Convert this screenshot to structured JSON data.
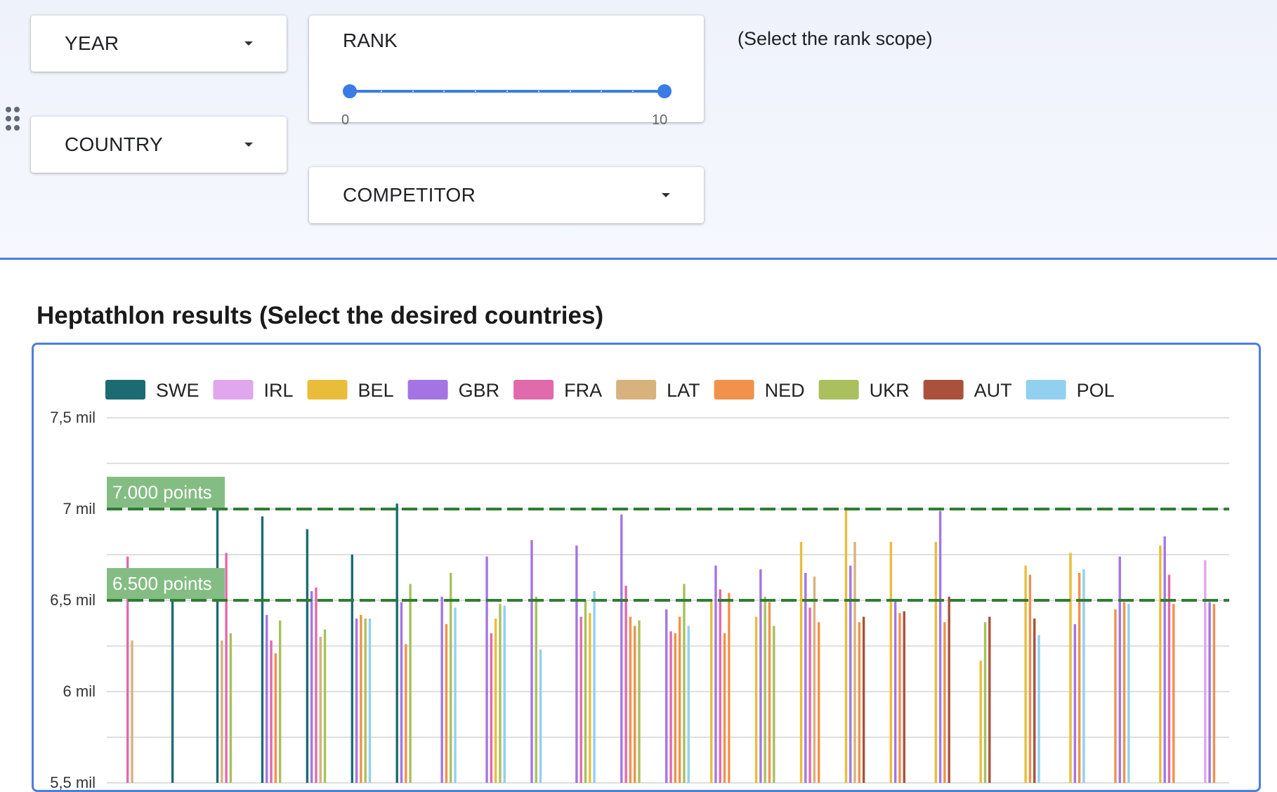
{
  "filters": {
    "year_label": "YEAR",
    "country_label": "COUNTRY",
    "competitor_label": "COMPETITOR",
    "rank": {
      "label": "RANK",
      "min": 0,
      "max": 10,
      "low": 0,
      "high": 10,
      "min_label": "0",
      "max_label": "10"
    },
    "rank_hint": "(Select the rank scope)"
  },
  "colors": {
    "accent": "#4a7fdd",
    "slider": "#3b7be6",
    "reference_line": "#2e7d32",
    "reference_label_bg": "#84bd84"
  },
  "chart": {
    "title": "Heptathlon results (Select the desired countries)"
  },
  "chart_data": {
    "type": "bar",
    "ylim": [
      5500,
      7500
    ],
    "y_ticks": [
      {
        "value": 7500,
        "label": "7,5 mil"
      },
      {
        "value": 7000,
        "label": "7 mil"
      },
      {
        "value": 6500,
        "label": "6,5 mil"
      },
      {
        "value": 6000,
        "label": "6 mil"
      },
      {
        "value": 5500,
        "label": "5,5 mil"
      }
    ],
    "grid_values": [
      7500,
      7250,
      7000,
      6750,
      6500,
      6250,
      6000,
      5750,
      5500
    ],
    "grid": true,
    "legend_position": "top",
    "reference_lines": [
      {
        "value": 7000,
        "label": "7.000 points"
      },
      {
        "value": 6500,
        "label": "6.500 points"
      }
    ],
    "series": [
      {
        "name": "SWE",
        "color": "#1c6b73"
      },
      {
        "name": "IRL",
        "color": "#e0a6ee"
      },
      {
        "name": "BEL",
        "color": "#e9bd3a"
      },
      {
        "name": "GBR",
        "color": "#a475e2"
      },
      {
        "name": "FRA",
        "color": "#e06aab"
      },
      {
        "name": "LAT",
        "color": "#d7b27c"
      },
      {
        "name": "NED",
        "color": "#f0924a"
      },
      {
        "name": "UKR",
        "color": "#a9c05d"
      },
      {
        "name": "AUT",
        "color": "#a9513c"
      },
      {
        "name": "POL",
        "color": "#91d0ef"
      }
    ],
    "groups": [
      [
        [
          "FRA",
          6740
        ],
        [
          "LAT",
          6280
        ]
      ],
      [
        [
          "SWE",
          6500
        ]
      ],
      [
        [
          "SWE",
          7000
        ],
        [
          "LAT",
          6280
        ],
        [
          "FRA",
          6760
        ],
        [
          "UKR",
          6320
        ]
      ],
      [
        [
          "SWE",
          6960
        ],
        [
          "GBR",
          6420
        ],
        [
          "FRA",
          6280
        ],
        [
          "NED",
          6210
        ],
        [
          "UKR",
          6390
        ]
      ],
      [
        [
          "SWE",
          6890
        ],
        [
          "GBR",
          6550
        ],
        [
          "FRA",
          6570
        ],
        [
          "LAT",
          6300
        ],
        [
          "UKR",
          6340
        ]
      ],
      [
        [
          "SWE",
          6750
        ],
        [
          "GBR",
          6400
        ],
        [
          "NED",
          6420
        ],
        [
          "UKR",
          6400
        ],
        [
          "POL",
          6400
        ]
      ],
      [
        [
          "SWE",
          7030
        ],
        [
          "GBR",
          6490
        ],
        [
          "NED",
          6260
        ],
        [
          "UKR",
          6590
        ]
      ],
      [
        [
          "GBR",
          6520
        ],
        [
          "NED",
          6370
        ],
        [
          "UKR",
          6650
        ],
        [
          "POL",
          6460
        ]
      ],
      [
        [
          "GBR",
          6740
        ],
        [
          "FRA",
          6320
        ],
        [
          "BEL",
          6400
        ],
        [
          "UKR",
          6480
        ],
        [
          "POL",
          6470
        ]
      ],
      [
        [
          "GBR",
          6830
        ],
        [
          "UKR",
          6520
        ],
        [
          "POL",
          6230
        ]
      ],
      [
        [
          "GBR",
          6800
        ],
        [
          "FRA",
          6410
        ],
        [
          "UKR",
          6500
        ],
        [
          "BEL",
          6430
        ],
        [
          "POL",
          6550
        ]
      ],
      [
        [
          "GBR",
          6970
        ],
        [
          "FRA",
          6580
        ],
        [
          "NED",
          6410
        ],
        [
          "NED",
          6360
        ],
        [
          "UKR",
          6390
        ]
      ],
      [
        [
          "GBR",
          6450
        ],
        [
          "FRA",
          6330
        ],
        [
          "NED",
          6320
        ],
        [
          "NED",
          6410
        ],
        [
          "UKR",
          6590
        ],
        [
          "POL",
          6360
        ]
      ],
      [
        [
          "BEL",
          6500
        ],
        [
          "GBR",
          6690
        ],
        [
          "FRA",
          6560
        ],
        [
          "NED",
          6320
        ],
        [
          "NED",
          6540
        ]
      ],
      [
        [
          "BEL",
          6410
        ],
        [
          "GBR",
          6670
        ],
        [
          "UKR",
          6520
        ],
        [
          "NED",
          6490
        ],
        [
          "UKR",
          6360
        ]
      ],
      [
        [
          "BEL",
          6820
        ],
        [
          "GBR",
          6650
        ],
        [
          "FRA",
          6460
        ],
        [
          "LAT",
          6630
        ],
        [
          "NED",
          6380
        ]
      ],
      [
        [
          "BEL",
          7010
        ],
        [
          "GBR",
          6690
        ],
        [
          "LAT",
          6820
        ],
        [
          "NED",
          6380
        ],
        [
          "AUT",
          6410
        ]
      ],
      [
        [
          "BEL",
          6820
        ],
        [
          "GBR",
          6500
        ],
        [
          "NED",
          6430
        ],
        [
          "AUT",
          6440
        ]
      ],
      [
        [
          "BEL",
          6820
        ],
        [
          "GBR",
          6990
        ],
        [
          "NED",
          6380
        ],
        [
          "AUT",
          6520
        ]
      ],
      [
        [
          "BEL",
          6170
        ],
        [
          "UKR",
          6380
        ],
        [
          "AUT",
          6410
        ]
      ],
      [
        [
          "BEL",
          6690
        ],
        [
          "NED",
          6640
        ],
        [
          "AUT",
          6400
        ],
        [
          "POL",
          6310
        ]
      ],
      [
        [
          "BEL",
          6760
        ],
        [
          "GBR",
          6370
        ],
        [
          "NED",
          6650
        ],
        [
          "POL",
          6670
        ]
      ],
      [
        [
          "NED",
          6450
        ],
        [
          "GBR",
          6740
        ],
        [
          "NED",
          6490
        ],
        [
          "POL",
          6480
        ]
      ],
      [
        [
          "BEL",
          6800
        ],
        [
          "GBR",
          6850
        ],
        [
          "FRA",
          6640
        ],
        [
          "NED",
          6480
        ]
      ],
      [
        [
          "IRL",
          6720
        ],
        [
          "GBR",
          6490
        ],
        [
          "NED",
          6480
        ]
      ]
    ]
  }
}
